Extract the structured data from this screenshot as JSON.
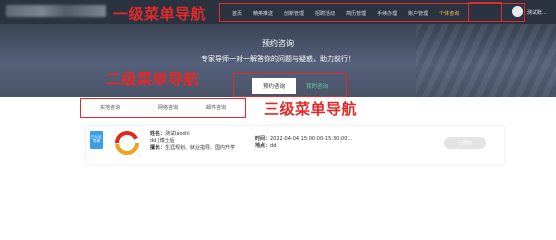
{
  "header": {
    "nav": [
      {
        "label": "首页",
        "active": false
      },
      {
        "label": "精英推送",
        "active": false
      },
      {
        "label": "创新管理",
        "active": false
      },
      {
        "label": "招聘活动",
        "active": false
      },
      {
        "label": "简历管理",
        "active": false
      },
      {
        "label": "手续办理",
        "active": false
      },
      {
        "label": "账户管理",
        "active": false
      },
      {
        "label": "个体咨询",
        "active": true
      }
    ],
    "username": "测试账..."
  },
  "hero": {
    "title": "预约咨询",
    "subtitle": "专家导师一对一解答你的问题与疑惑，助力前行！"
  },
  "annotations": {
    "level1": "一级菜单导航",
    "level2": "二级菜单导航",
    "level3": "三级菜单导航"
  },
  "tabs_level2": [
    {
      "label": "预约咨询",
      "active": true
    },
    {
      "label": "我的咨询",
      "active": false
    }
  ],
  "tabs_level3": [
    {
      "label": "实地咨询"
    },
    {
      "label": "网络咨询"
    },
    {
      "label": "邮件咨询"
    }
  ],
  "consultant": {
    "badge": "已认证导师",
    "name_label": "姓名：",
    "name": "测试laoshi",
    "title": "dd |博士后",
    "field_label": "擅长：",
    "field": "生涯规划、就业指导、国内升学",
    "time_label": "时间：",
    "time": "2022-04-04  15:00:00-15:30:00...",
    "place_label": "地点：",
    "place": "dd",
    "button_label": "已预约"
  },
  "colors": {
    "header_bg": "#2b3340",
    "annotation_red": "#e12b2b",
    "active_nav": "#f2c14e",
    "tab_green": "#58d0a2",
    "badge_blue": "#3aa0e6"
  }
}
